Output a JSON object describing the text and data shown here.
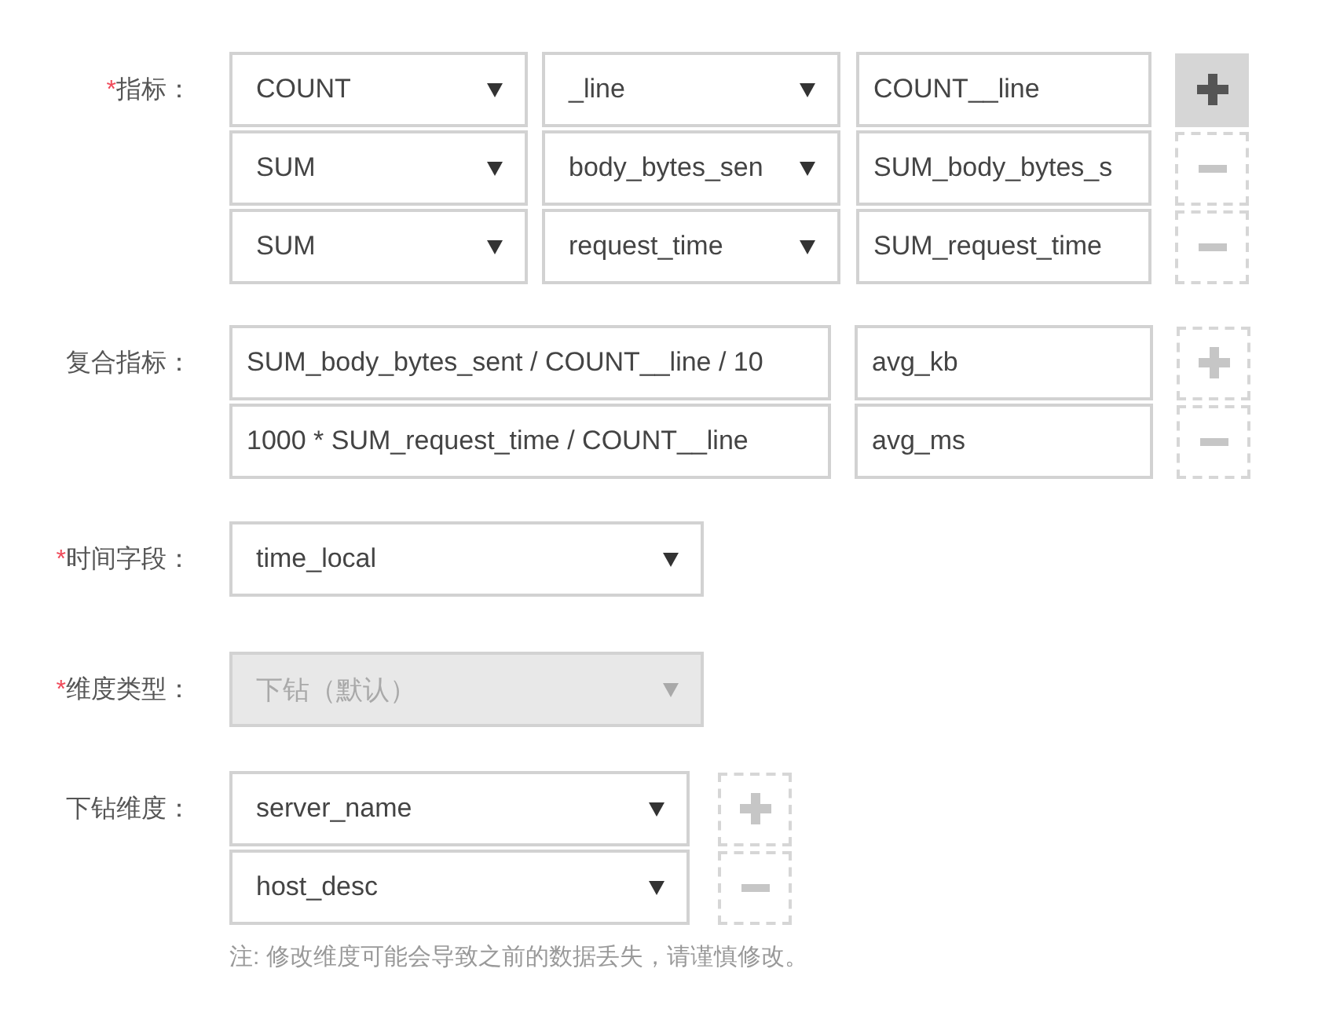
{
  "metrics": {
    "required_mark": "*",
    "label": "指标：",
    "rows": [
      {
        "function": "COUNT",
        "column": "_line",
        "alias": "COUNT__line",
        "action": {
          "kind": "add",
          "highlighted": true
        }
      },
      {
        "function": "SUM",
        "column": "body_bytes_sen",
        "alias": "SUM_body_bytes_s",
        "action": {
          "kind": "remove",
          "highlighted": false
        }
      },
      {
        "function": "SUM",
        "column": "request_time",
        "alias": "SUM_request_time",
        "action": {
          "kind": "remove",
          "highlighted": false
        }
      }
    ]
  },
  "composite_metrics": {
    "label": "复合指标：",
    "rows": [
      {
        "formula": "SUM_body_bytes_sent / COUNT__line / 10",
        "alias": "avg_kb",
        "action": {
          "kind": "add",
          "highlighted": false
        }
      },
      {
        "formula": "1000 * SUM_request_time / COUNT__line",
        "alias": "avg_ms",
        "action": {
          "kind": "remove",
          "highlighted": false
        }
      }
    ]
  },
  "time_field": {
    "required_mark": "*",
    "label": "时间字段：",
    "value": "time_local",
    "disabled": false
  },
  "dimension_type": {
    "required_mark": "*",
    "label": "维度类型：",
    "value": "下钻（默认）",
    "disabled": true
  },
  "drilldown_dimensions": {
    "label": "下钻维度：",
    "rows": [
      {
        "value": "server_name",
        "action": {
          "kind": "add",
          "highlighted": false
        }
      },
      {
        "value": "host_desc",
        "action": {
          "kind": "remove",
          "highlighted": false
        }
      }
    ],
    "note": "注: 修改维度可能会导致之前的数据丢失，请谨慎修改。"
  }
}
